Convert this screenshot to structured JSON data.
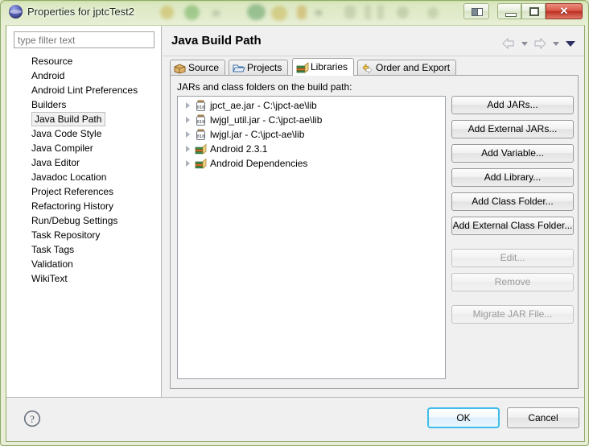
{
  "window": {
    "title": "Properties for jptcTest2",
    "app_icon": "eclipse-sphere-icon",
    "caption_buttons": [
      {
        "name": "panel-toggle",
        "label": ""
      },
      {
        "name": "minimize",
        "label": ""
      },
      {
        "name": "maximize",
        "label": ""
      },
      {
        "name": "close",
        "label": "✕"
      }
    ]
  },
  "sidebar": {
    "filter": {
      "placeholder": "type filter text",
      "value": ""
    },
    "selected": "Java Build Path",
    "items": [
      {
        "label": "Resource"
      },
      {
        "label": "Android"
      },
      {
        "label": "Android Lint Preferences"
      },
      {
        "label": "Builders"
      },
      {
        "label": "Java Build Path"
      },
      {
        "label": "Java Code Style"
      },
      {
        "label": "Java Compiler"
      },
      {
        "label": "Java Editor"
      },
      {
        "label": "Javadoc Location"
      },
      {
        "label": "Project References"
      },
      {
        "label": "Refactoring History"
      },
      {
        "label": "Run/Debug Settings"
      },
      {
        "label": "Task Repository"
      },
      {
        "label": "Task Tags"
      },
      {
        "label": "Validation"
      },
      {
        "label": "WikiText"
      }
    ]
  },
  "pane": {
    "title": "Java Build Path",
    "tabs": [
      {
        "label": "Source",
        "icon": "package-icon",
        "active": false
      },
      {
        "label": "Projects",
        "icon": "folder-open-icon",
        "active": false
      },
      {
        "label": "Libraries",
        "icon": "books-icon",
        "active": true
      },
      {
        "label": "Order and Export",
        "icon": "order-arrows-icon",
        "active": false
      }
    ],
    "content_label": "JARs and class folders on the build path:",
    "entries": [
      {
        "label": "jpct_ae.jar - C:\\jpct-ae\\lib",
        "icon": "jar-icon"
      },
      {
        "label": "lwjgl_util.jar - C:\\jpct-ae\\lib",
        "icon": "jar-icon"
      },
      {
        "label": "lwjgl.jar - C:\\jpct-ae\\lib",
        "icon": "jar-icon"
      },
      {
        "label": "Android 2.3.1",
        "icon": "library-icon"
      },
      {
        "label": "Android Dependencies",
        "icon": "library-icon"
      }
    ],
    "buttons": [
      {
        "label": "Add JARs...",
        "enabled": true
      },
      {
        "label": "Add External JARs...",
        "enabled": true
      },
      {
        "label": "Add Variable...",
        "enabled": true
      },
      {
        "label": "Add Library...",
        "enabled": true
      },
      {
        "label": "Add Class Folder...",
        "enabled": true
      },
      {
        "label": "Add External Class Folder...",
        "enabled": true
      },
      {
        "label": "Edit...",
        "enabled": false
      },
      {
        "label": "Remove",
        "enabled": false
      },
      {
        "label": "Migrate JAR File...",
        "enabled": false
      }
    ]
  },
  "footer": {
    "help_icon": "question-mark-icon",
    "ok_label": "OK",
    "cancel_label": "Cancel"
  },
  "colors": {
    "frame": "#8fa96a",
    "titlebar": "#dce8c2",
    "accent_ok_border": "#3fbdea",
    "close_button": "#d9584a",
    "selection": "#f0f0f0"
  }
}
